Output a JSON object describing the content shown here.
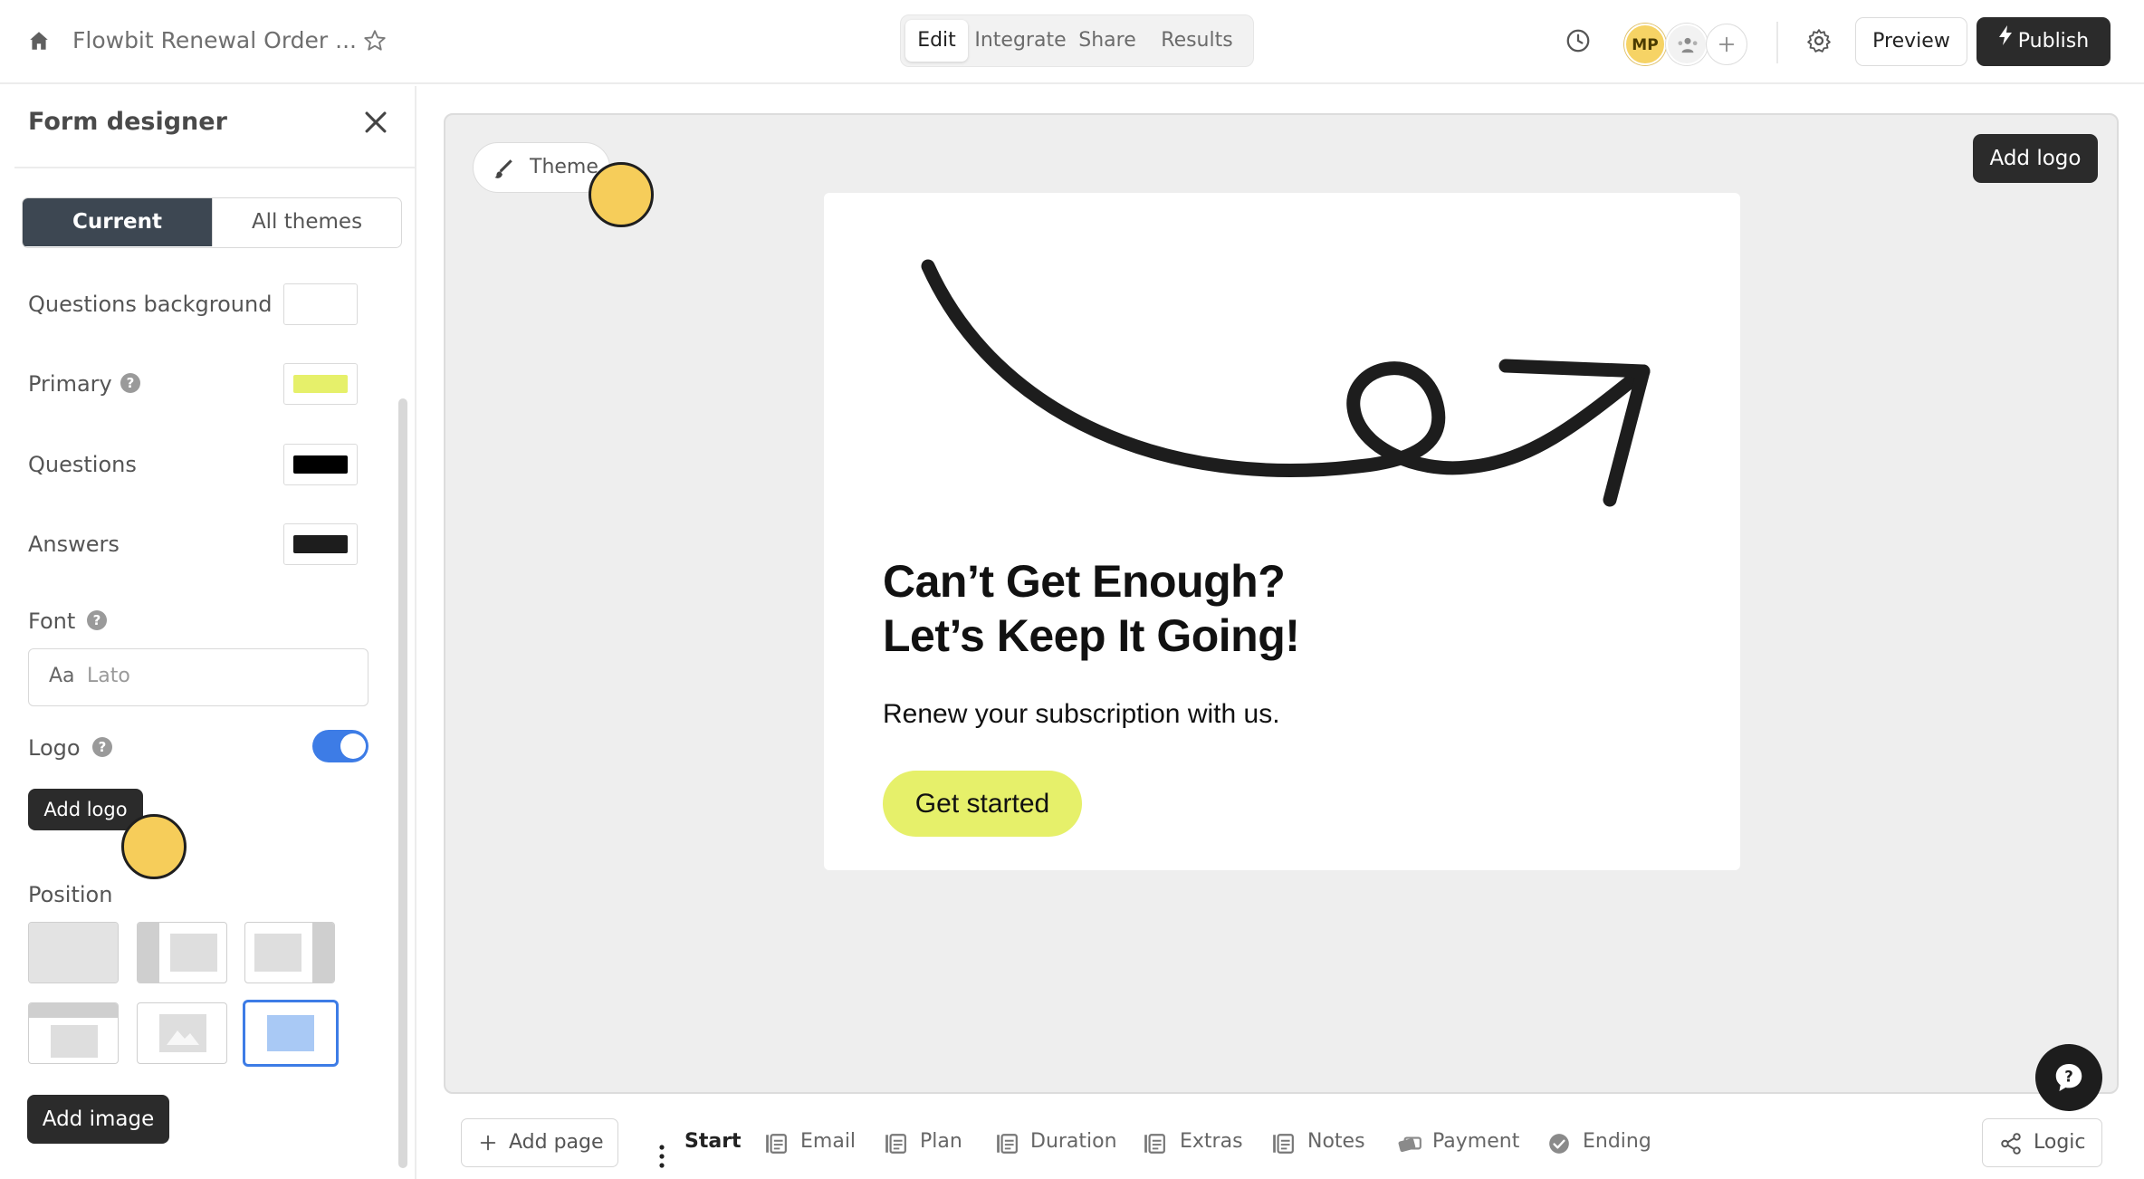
{
  "header": {
    "form_title": "Flowbit Renewal Order ...",
    "tabs": [
      {
        "label": "Edit",
        "active": true
      },
      {
        "label": "Integrate",
        "active": false
      },
      {
        "label": "Share",
        "active": false
      },
      {
        "label": "Results",
        "active": false
      }
    ],
    "avatar_initials": "MP",
    "preview_label": "Preview",
    "publish_label": "Publish"
  },
  "panel": {
    "title": "Form designer",
    "tabs": {
      "current": "Current",
      "all_themes": "All themes"
    },
    "colors": [
      {
        "label": "Questions background",
        "value": "#ffffff",
        "has_help": false
      },
      {
        "label": "Primary",
        "value": "#e6f06a",
        "has_help": true
      },
      {
        "label": "Questions",
        "value": "#000000",
        "has_help": false
      },
      {
        "label": "Answers",
        "value": "#1d1d1d",
        "has_help": false
      }
    ],
    "font_label": "Font",
    "font_prefix": "Aa",
    "font_value": "Lato",
    "logo_label": "Logo",
    "logo_enabled": true,
    "add_logo_tooltip": "Add logo",
    "position_label": "Position",
    "selected_position": "full-background",
    "add_image_label": "Add image"
  },
  "canvas": {
    "theme_label": "Theme",
    "add_logo_label": "Add logo",
    "headline_line1": "Can’t Get Enough?",
    "headline_line2": "Let’s Keep It Going!",
    "subtitle": "Renew your subscription with us.",
    "cta_label": "Get started"
  },
  "bottom": {
    "add_page_label": "Add page",
    "pages": [
      {
        "label": "Start",
        "icon": "play-icon",
        "active": true
      },
      {
        "label": "Email",
        "icon": "form-field-icon",
        "active": false
      },
      {
        "label": "Plan",
        "icon": "form-field-icon",
        "active": false
      },
      {
        "label": "Duration",
        "icon": "form-field-icon",
        "active": false
      },
      {
        "label": "Extras",
        "icon": "form-field-icon",
        "active": false
      },
      {
        "label": "Notes",
        "icon": "form-field-icon",
        "active": false
      },
      {
        "label": "Payment",
        "icon": "payment-icon",
        "active": false
      },
      {
        "label": "Ending",
        "icon": "check-circle-icon",
        "active": false
      }
    ],
    "logic_label": "Logic"
  },
  "colors": {
    "accent": "#3d7ce6",
    "primary": "#e6f06a",
    "dark": "#2b2b2b",
    "cursor": "#f6cd5a"
  }
}
